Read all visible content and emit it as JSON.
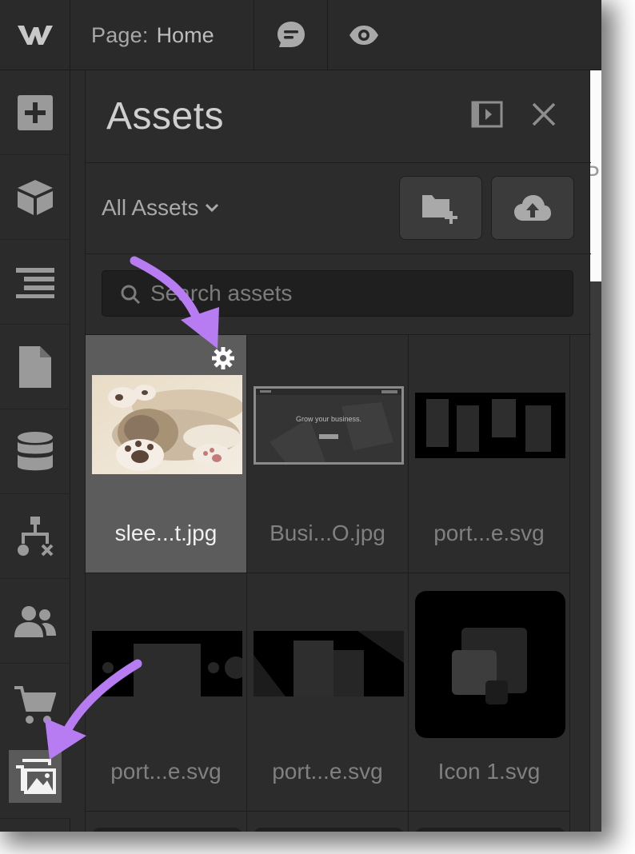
{
  "topbar": {
    "logo": "webflow-logo-icon",
    "page_label": "Page:",
    "page_name": "Home",
    "comment_icon": "comment-icon",
    "preview_icon": "eye-icon"
  },
  "rail": [
    {
      "name": "add-icon"
    },
    {
      "name": "components-icon"
    },
    {
      "name": "navigator-icon"
    },
    {
      "name": "pages-icon"
    },
    {
      "name": "cms-icon"
    },
    {
      "name": "logic-icon"
    },
    {
      "name": "users-icon"
    },
    {
      "name": "ecommerce-icon"
    },
    {
      "name": "assets-icon",
      "selected": true
    }
  ],
  "panel": {
    "title": "Assets",
    "filter_label": "All Assets",
    "search_placeholder": "Search assets"
  },
  "canvas": {
    "partial_text": "POR"
  },
  "assets": [
    {
      "name": "slee...t.jpg",
      "kind": "cat-photo",
      "selected": true
    },
    {
      "name": "Busi...O.jpg",
      "kind": "website-screenshot",
      "caption": "Grow your business."
    },
    {
      "name": "port...e.svg",
      "kind": "dark-grid"
    },
    {
      "name": "port...e.svg",
      "kind": "dark-shapes-1"
    },
    {
      "name": "port...e.svg",
      "kind": "dark-shapes-2"
    },
    {
      "name": "Icon 1.svg",
      "kind": "icon-squares"
    }
  ],
  "colors": {
    "background": "#2b2b2b",
    "panel": "#2c2c2c",
    "selected_tile": "#5c5c5c",
    "annotation_arrow": "#b77cf2"
  }
}
